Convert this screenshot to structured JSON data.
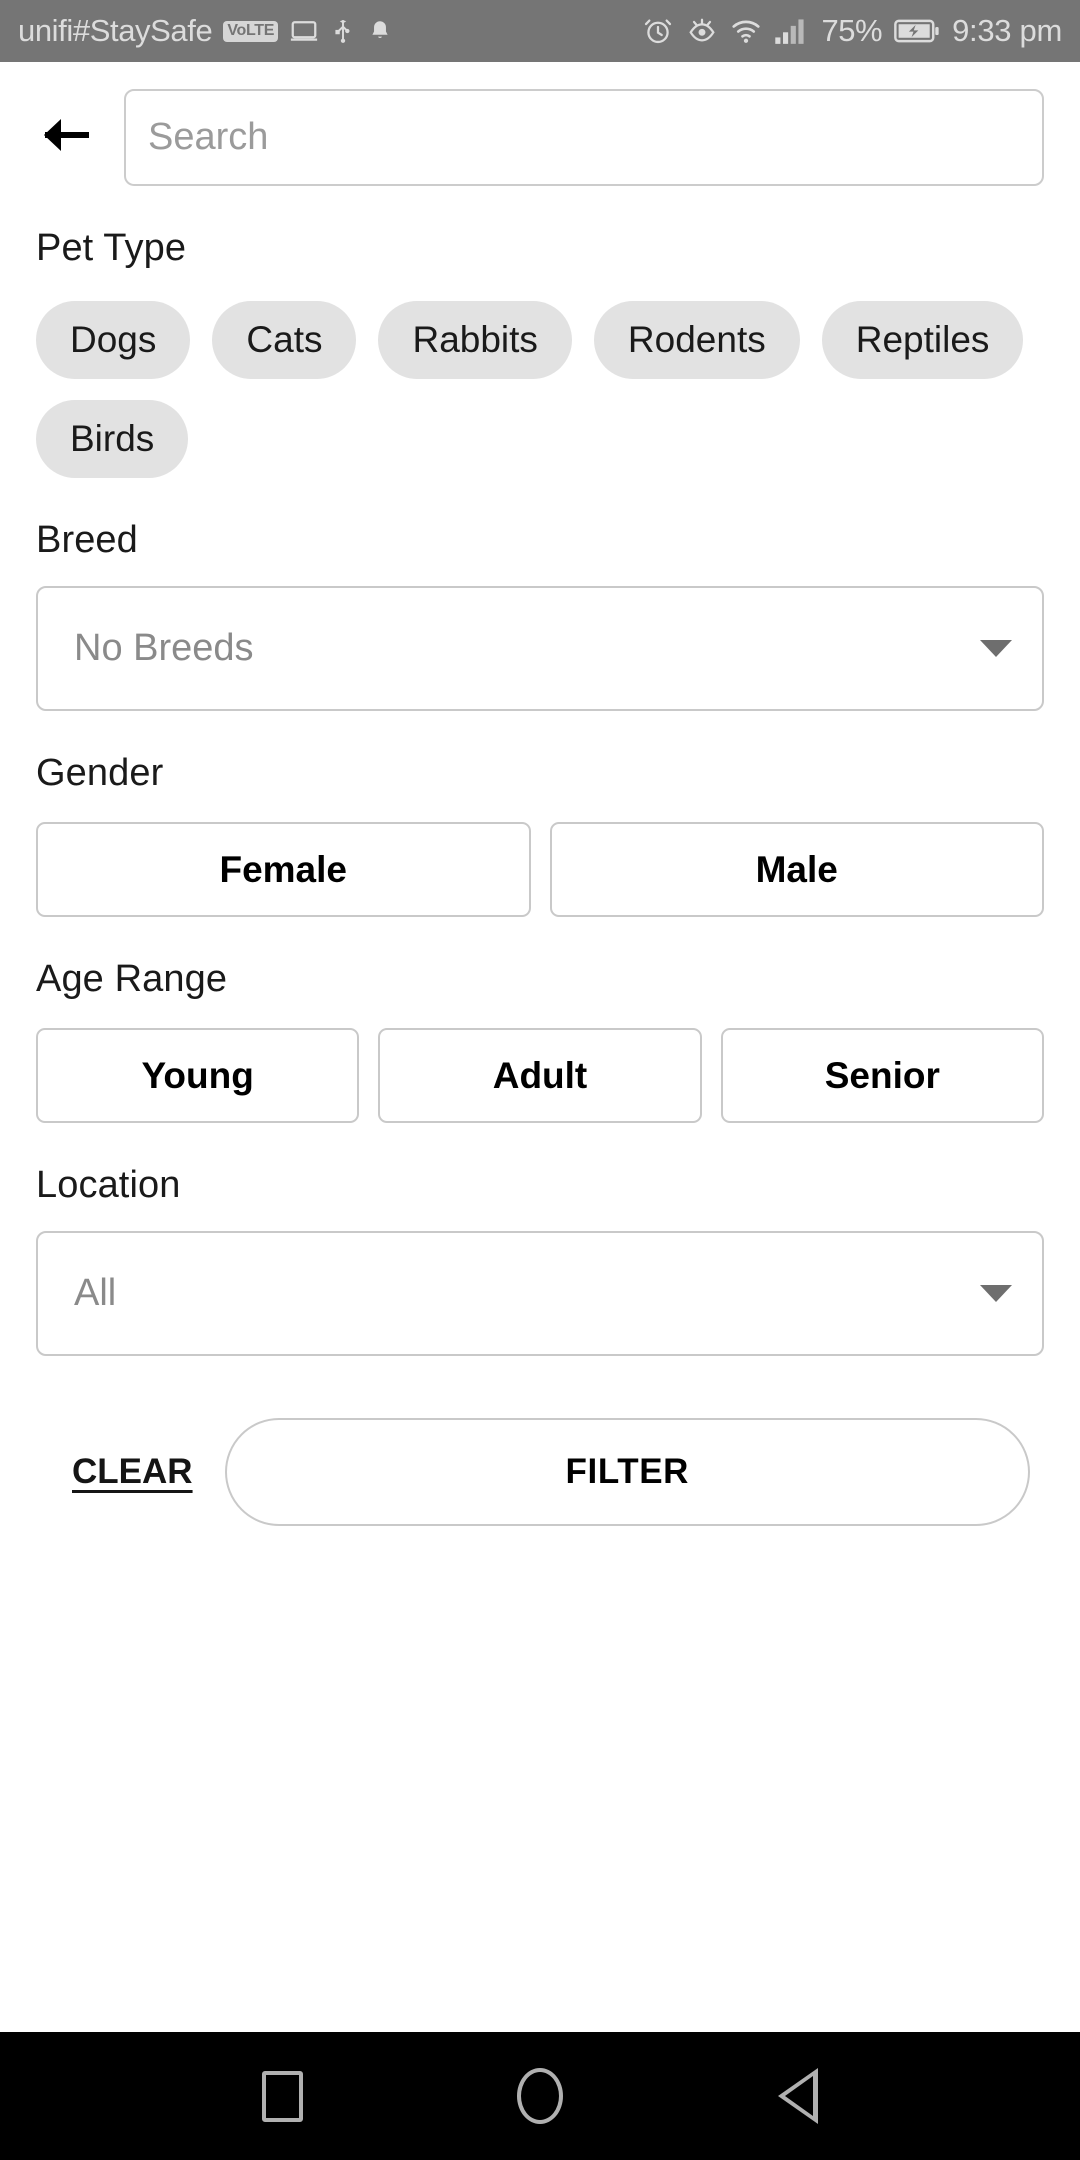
{
  "status_bar": {
    "carrier": "unifi#StaySafe",
    "volte": "VoLTE",
    "battery_percent": "75%",
    "time": "9:33 pm",
    "icons": [
      "volte-badge",
      "tablet-icon",
      "usb-icon",
      "bell-icon",
      "alarm-icon",
      "eye-comfort-icon",
      "wifi-icon",
      "signal-bars-icon",
      "battery-charging-icon"
    ]
  },
  "header": {
    "back_icon": "back-arrow-icon",
    "search_placeholder": "Search",
    "search_value": ""
  },
  "pet_type": {
    "title": "Pet Type",
    "options": [
      "Dogs",
      "Cats",
      "Rabbits",
      "Rodents",
      "Reptiles",
      "Birds"
    ]
  },
  "breed": {
    "title": "Breed",
    "selected": "No Breeds",
    "arrow_icon": "chevron-down-icon"
  },
  "gender": {
    "title": "Gender",
    "options": [
      "Female",
      "Male"
    ]
  },
  "age_range": {
    "title": "Age Range",
    "options": [
      "Young",
      "Adult",
      "Senior"
    ]
  },
  "location": {
    "title": "Location",
    "selected": "All",
    "arrow_icon": "chevron-down-icon"
  },
  "actions": {
    "clear_label": "CLEAR",
    "filter_label": "FILTER"
  },
  "nav_bar": {
    "recents_icon": "square-recents-icon",
    "home_icon": "circle-home-icon",
    "back_icon": "triangle-back-icon"
  },
  "colors": {
    "status_bar_bg": "#757575",
    "chip_bg": "#e2e2e2",
    "border": "#c9c9c9",
    "placeholder": "#9b9b9b",
    "nav_bg": "#000000"
  }
}
